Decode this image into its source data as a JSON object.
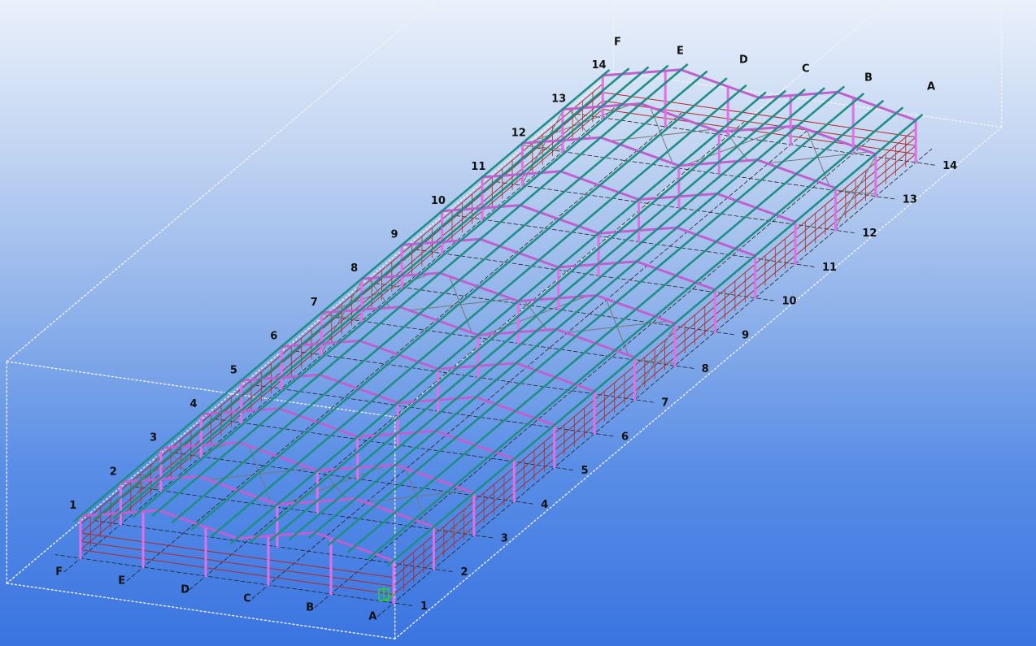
{
  "grid": {
    "numbers": [
      "1",
      "2",
      "3",
      "4",
      "5",
      "6",
      "7",
      "8",
      "9",
      "10",
      "11",
      "12",
      "13",
      "14"
    ],
    "letters": [
      "A",
      "B",
      "C",
      "D",
      "E",
      "F"
    ]
  },
  "colors": {
    "column": "#e070e8",
    "rafter": "#c060d0",
    "purlin": "#1f8f86",
    "girt": "#b02a2a",
    "brace": "#777777",
    "gridline": "#222222",
    "bbox": "#f2f2f2"
  },
  "icons": {
    "ucs": "axis-triad-icon"
  }
}
